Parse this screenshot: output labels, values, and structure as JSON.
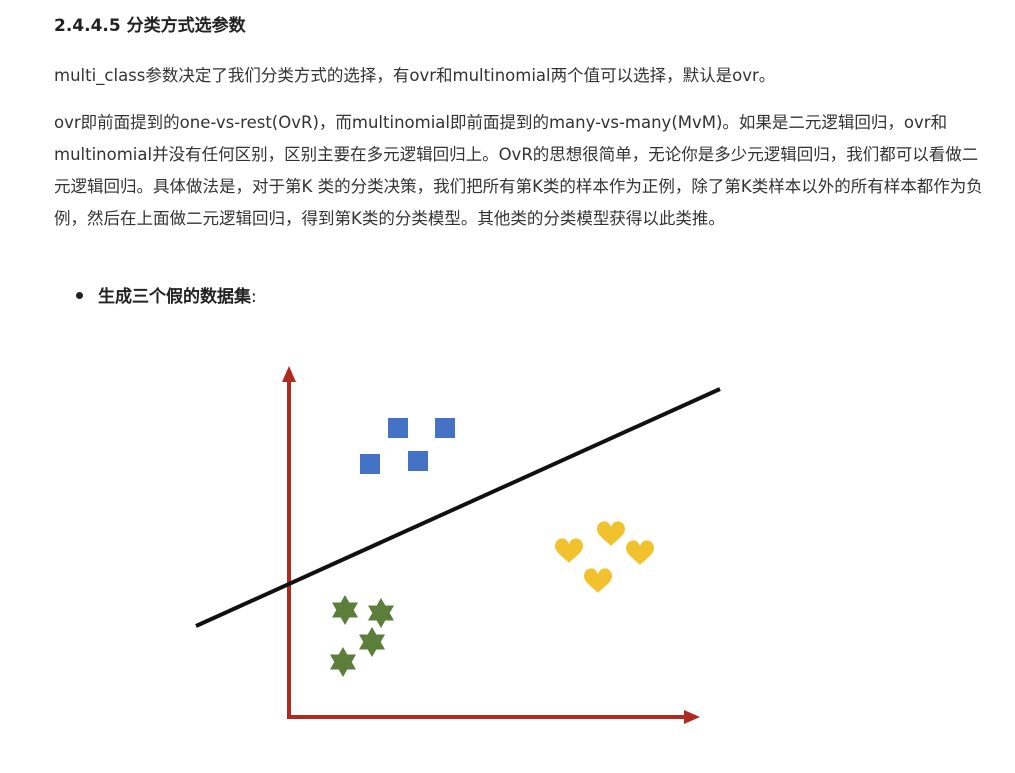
{
  "heading": "2.4.4.5 分类方式选参数",
  "paragraphs": [
    "multi_class参数决定了我们分类方式的选择，有ovr和multinomial两个值可以选择，默认是ovr。",
    "ovr即前面提到的one-vs-rest(OvR)，而multinomial即前面提到的many-vs-many(MvM)。如果是二元逻辑回归，ovr和multinomial并没有任何区别，区别主要在多元逻辑回归上。OvR的思想很简单，无论你是多少元逻辑回归，我们都可以看做二元逻辑回归。具体做法是，对于第K 类的分类决策，我们把所有第K类的样本作为正例，除了第K类样本以外的所有样本都作为负例，然后在上面做二元逻辑回归，得到第K类的分类模型。其他类的分类模型获得以此类推。"
  ],
  "bullet": {
    "text": "生成三个假的数据集",
    "suffix": ":"
  },
  "figure": {
    "colors": {
      "axis": "#b02a20",
      "line": "#111111",
      "square": "#4472c4",
      "heart": "#f2c12e",
      "star": "#5b7f3a"
    },
    "icons": [
      "square-marker",
      "heart-marker",
      "star-marker"
    ]
  }
}
